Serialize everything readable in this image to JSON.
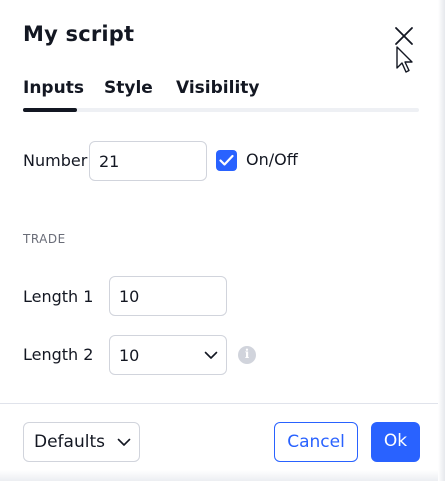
{
  "dialog": {
    "title": "My script"
  },
  "tabs": [
    {
      "label": "Inputs",
      "active": true
    },
    {
      "label": "Style",
      "active": false
    },
    {
      "label": "Visibility",
      "active": false
    }
  ],
  "inputs": {
    "number_label": "Number",
    "number_value": "21",
    "onoff_label": "On/Off",
    "onoff_checked": true
  },
  "trade": {
    "section_label": "TRADE",
    "length1_label": "Length 1",
    "length1_value": "10",
    "length2_label": "Length 2",
    "length2_value": "10",
    "info_glyph": "i"
  },
  "footer": {
    "defaults_label": "Defaults",
    "cancel_label": "Cancel",
    "ok_label": "Ok"
  },
  "colors": {
    "accent": "#2962ff",
    "text": "#131722",
    "muted": "#6a6d78",
    "border": "#d1d4dc"
  },
  "icons": {
    "close": "close-icon",
    "checkbox": "checkmark-icon",
    "select": "chevron-down-icon",
    "info": "info-icon",
    "cursor": "mouse-cursor-icon"
  }
}
